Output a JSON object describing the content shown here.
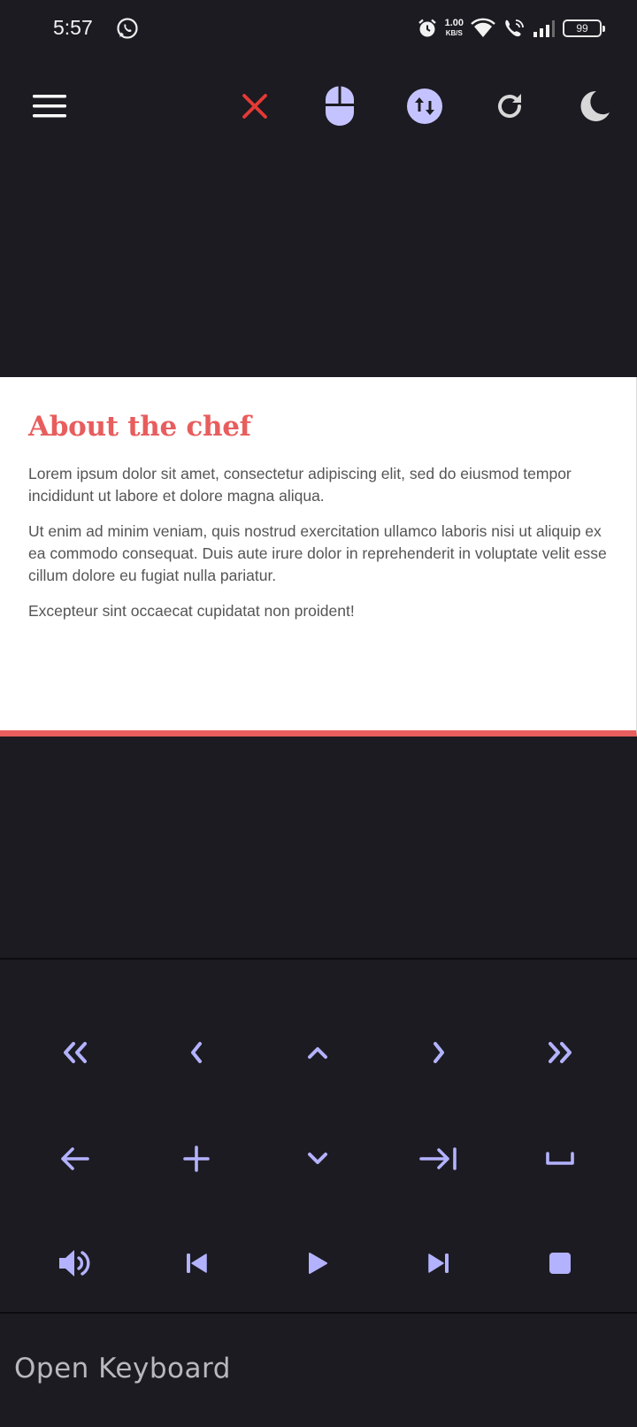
{
  "status_bar": {
    "time": "5:57",
    "net_speed_value": "1.00",
    "net_speed_unit": "KB/S",
    "battery": "99",
    "icons": [
      "whatsapp-icon",
      "alarm-icon",
      "wifi-icon",
      "wifi-call-icon",
      "signal-icon",
      "battery-icon"
    ]
  },
  "toolbar": {
    "icons": [
      "menu-icon",
      "close-icon",
      "mouse-icon",
      "scroll-toggle-icon",
      "refresh-icon",
      "dark-mode-icon"
    ],
    "colors": {
      "close": "#e53935",
      "accent": "#c5c3ff",
      "neutral": "#d8d8d8"
    }
  },
  "card": {
    "title": "About the chef",
    "paragraphs": [
      "Lorem ipsum dolor sit amet, consectetur adipiscing elit, sed do eiusmod tempor incididunt ut labore et dolore magna aliqua.",
      "Ut enim ad minim veniam, quis nostrud exercitation ullamco laboris nisi ut aliquip ex ea commodo consequat. Duis aute irure dolor in reprehenderit in voluptate velit esse cillum dolore eu fugiat nulla pariatur.",
      "Excepteur sint occaecat cupidatat non proident!"
    ],
    "accent_color": "#e85d5d"
  },
  "keypad": {
    "rows": [
      [
        "double-chevron-left-icon",
        "chevron-left-icon",
        "chevron-up-icon",
        "chevron-right-icon",
        "double-chevron-right-icon"
      ],
      [
        "arrow-left-icon",
        "plus-icon",
        "chevron-down-icon",
        "tab-icon",
        "space-icon"
      ],
      [
        "volume-icon",
        "skip-previous-icon",
        "play-icon",
        "skip-next-icon",
        "stop-icon"
      ]
    ],
    "icon_color": "#b3b2ff"
  },
  "footer": {
    "open_keyboard_label": "Open Keyboard"
  }
}
